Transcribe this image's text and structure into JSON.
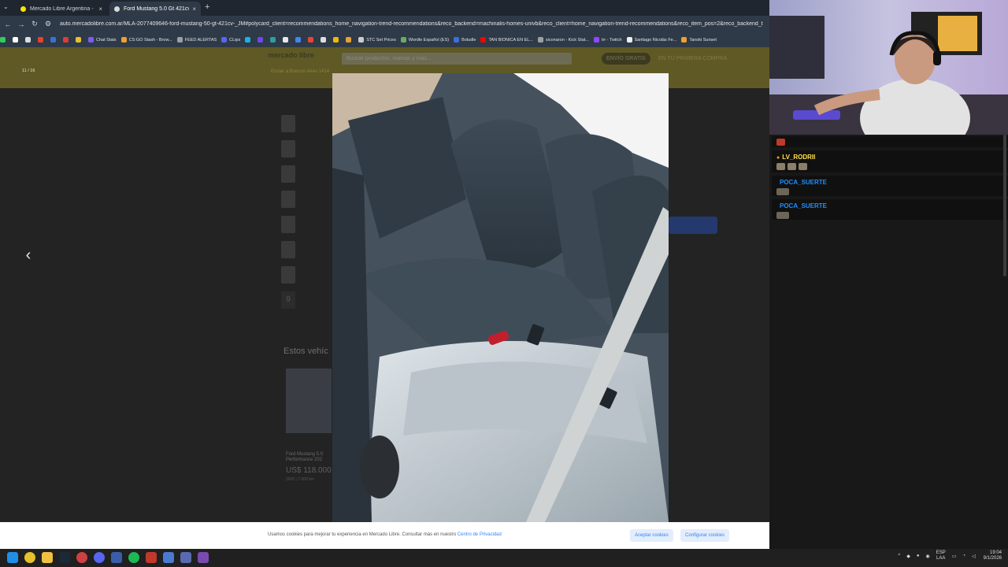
{
  "browser": {
    "tabs": [
      {
        "title": "Mercado Libre Argentina - Env",
        "active": false
      },
      {
        "title": "Ford Mustang 5.0 Gt 421cv | M",
        "active": true
      }
    ],
    "new_tab_label": "+",
    "url": "auto.mercadolibre.com.ar/MLA-2077409646-ford-mustang-50-gt-421cv-_JM#polycard_client=recommendations_home_navigation-trend-recommendations&reco_backend=machinalis-homes-univb&reco_client=home_navigation-trend-recommendations&reco_item_pos=2&reco_backend_t",
    "bookmarks": [
      {
        "label": "",
        "color": "#2fd05a"
      },
      {
        "label": "",
        "color": "#ffffff"
      },
      {
        "label": "",
        "color": "#dddddd"
      },
      {
        "label": "",
        "color": "#e8412c"
      },
      {
        "label": "",
        "color": "#3b6fd8"
      },
      {
        "label": "",
        "color": "#e03a3a"
      },
      {
        "label": "",
        "color": "#e8c02c"
      },
      {
        "label": "Chat Stats",
        "color": "#7b5cf5"
      },
      {
        "label": "CS:GO Stash - Brow...",
        "color": "#f0a030"
      },
      {
        "label": "FEED ALERTAS",
        "color": "#9aa0a6"
      },
      {
        "label": "CLips",
        "color": "#5865f2"
      },
      {
        "label": "",
        "color": "#1bb0e8"
      },
      {
        "label": "",
        "color": "#7048e8"
      },
      {
        "label": "",
        "color": "#2ca0a0"
      },
      {
        "label": "",
        "color": "#e8e8e8"
      },
      {
        "label": "",
        "color": "#4285f4"
      },
      {
        "label": "",
        "color": "#ea4335"
      },
      {
        "label": "",
        "color": "#dddddd"
      },
      {
        "label": "",
        "color": "#f0b90b"
      },
      {
        "label": "",
        "color": "#e8a030"
      },
      {
        "label": "STC Set Prices",
        "color": "#cccccc"
      },
      {
        "label": "Wordle Español (ES)",
        "color": "#6aaa64"
      },
      {
        "label": "Boludle",
        "color": "#3b6fd8"
      },
      {
        "label": "TAN BIONICA EN EL...",
        "color": "#ff0000"
      },
      {
        "label": "siconaron - Kick Stat...",
        "color": "#9aa0a6"
      },
      {
        "label": "trr - Twitch",
        "color": "#9146ff"
      },
      {
        "label": "Santiago Nicolás Fe...",
        "color": "#eeeeee"
      },
      {
        "label": "Tanoki Sunset",
        "color": "#f0a030"
      }
    ]
  },
  "site": {
    "logo": "mercado libre",
    "search_placeholder": "Buscar productos, marcas y más...",
    "promo_badge": "ENVÍO GRATIS",
    "promo_text": "EN TU PRIMERA COMPRA",
    "location": "Enviar a Buenos Aires 1414",
    "similar_title": "Estos vehíc",
    "similar_card": {
      "name": "Ford Mustang 5.0 Performance 202",
      "price": "US$ 118.000",
      "meta": "2020 | 7.000 km"
    }
  },
  "lightbox": {
    "counter": "11 / 16",
    "thumb_last_label": "9",
    "prev_label": "‹",
    "next_label": "›"
  },
  "cookie": {
    "text": "Usamos cookies para mejorar tu experiencia en Mercado Libre. Consultar más en nuestro",
    "link": "Centro de Privacidad",
    "accept": "Aceptar cookies",
    "configure": "Configurar cookies"
  },
  "chat": {
    "messages": [
      {
        "user": "LV_RODRII",
        "color": "#ffe24a",
        "emotes": 3
      },
      {
        "user": "POCA_SUERTE",
        "color": "#1e90ff",
        "emotes": 1
      },
      {
        "user": "POCA_SUERTE",
        "color": "#1e90ff",
        "emotes": 1
      }
    ]
  },
  "taskbar": {
    "lang_top": "ESP",
    "lang_bottom": "LAA",
    "time": "19:04",
    "date": "9/1/2026"
  }
}
